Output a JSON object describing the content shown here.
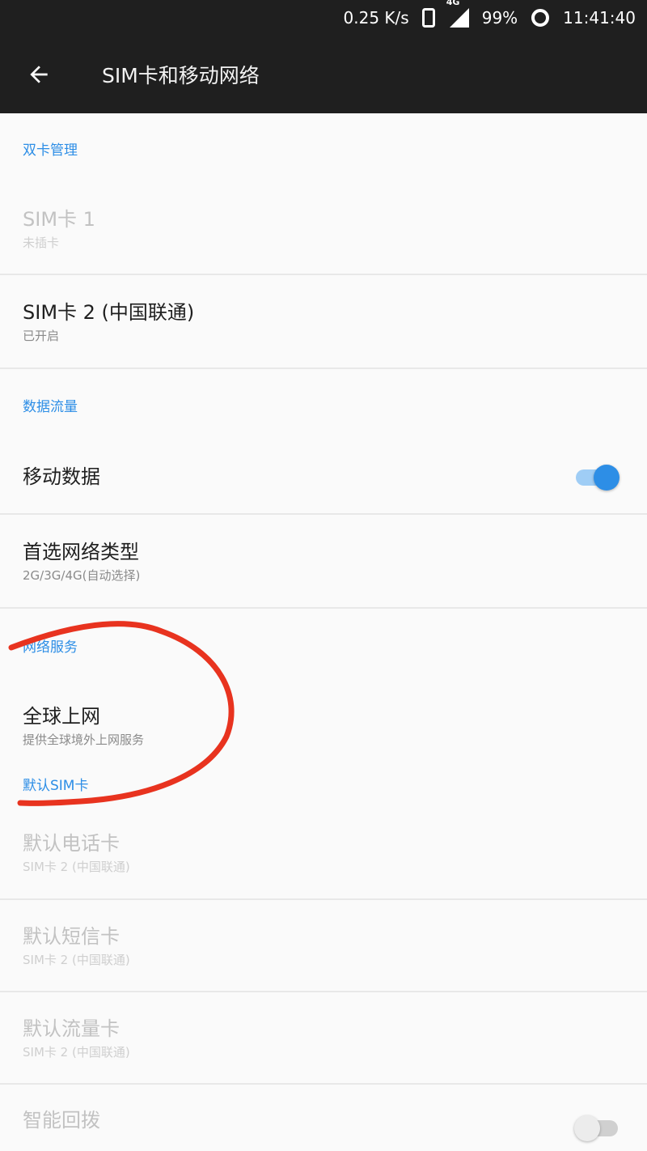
{
  "status_bar": {
    "speed": "0.25 K/s",
    "network": "4G",
    "battery": "99%",
    "time": "11:41:40"
  },
  "app_bar": {
    "title": "SIM卡和移动网络"
  },
  "sections": {
    "dual_sim": {
      "header": "双卡管理",
      "sim1": {
        "title": "SIM卡 1",
        "subtitle": "未插卡"
      },
      "sim2": {
        "title": "SIM卡 2 (中国联通)",
        "subtitle": "已开启"
      }
    },
    "data": {
      "header": "数据流量",
      "mobile_data": {
        "title": "移动数据",
        "toggle_on": true
      },
      "network_type": {
        "title": "首选网络类型",
        "subtitle": "2G/3G/4G(自动选择)"
      }
    },
    "network_service": {
      "header": "网络服务",
      "global_roaming": {
        "title": "全球上网",
        "subtitle": "提供全球境外上网服务"
      }
    },
    "default_sim": {
      "header": "默认SIM卡",
      "call": {
        "title": "默认电话卡",
        "subtitle": "SIM卡 2 (中国联通)"
      },
      "sms": {
        "title": "默认短信卡",
        "subtitle": "SIM卡 2 (中国联通)"
      },
      "data": {
        "title": "默认流量卡",
        "subtitle": "SIM卡 2 (中国联通)"
      },
      "smart_switch": {
        "title": "智能回拨"
      }
    }
  },
  "colors": {
    "accent": "#2d8ee6",
    "bar": "#1f1f1f",
    "annotation": "#e8331f"
  }
}
